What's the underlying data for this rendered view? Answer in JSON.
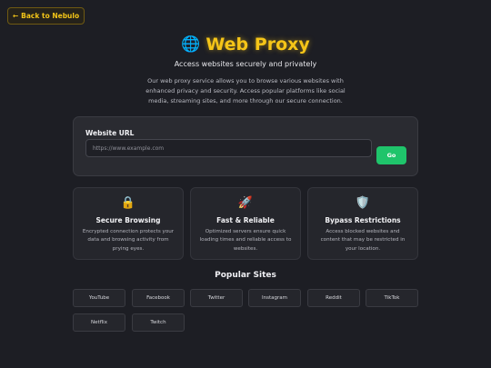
{
  "nav": {
    "back_arrow": "←",
    "back_label": "Back to Nebulo"
  },
  "header": {
    "icon": "globe-icon",
    "icon_glyph": "🌐",
    "title": "Web Proxy",
    "subtitle": "Access websites securely and privately",
    "description": "Our web proxy service allows you to browse various websites with enhanced privacy and security. Access popular platforms like social media, streaming sites, and more through our secure connection."
  },
  "url_form": {
    "label": "Website URL",
    "value": "",
    "placeholder": "https://www.example.com",
    "go_label": "Go"
  },
  "features": [
    {
      "icon": "lock-icon",
      "glyph": "🔒",
      "title": "Secure Browsing",
      "description": "Encrypted connection protects your data and browsing activity from prying eyes."
    },
    {
      "icon": "rocket-icon",
      "glyph": "🚀",
      "title": "Fast & Reliable",
      "description": "Optimized servers ensure quick loading times and reliable access to websites."
    },
    {
      "icon": "shield-icon",
      "glyph": "🛡️",
      "title": "Bypass Restrictions",
      "description": "Access blocked websites and content that may be restricted in your location."
    }
  ],
  "popular": {
    "title": "Popular Sites",
    "sites": [
      "YouTube",
      "Facebook",
      "Twitter",
      "Instagram",
      "Reddit",
      "TikTok",
      "Netflix",
      "Twitch"
    ]
  },
  "colors": {
    "background": "#1d1e24",
    "accent": "#f5c518",
    "go_button": "#1fc46b",
    "card": "#2a2b31"
  }
}
